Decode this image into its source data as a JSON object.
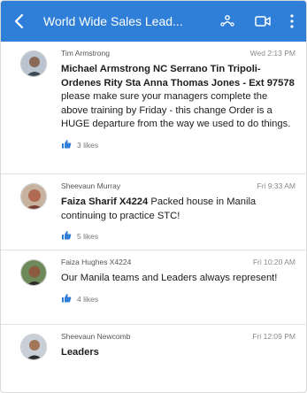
{
  "header": {
    "title": "World Wide Sales Lead...",
    "back_icon": "back-arrow-icon",
    "people_icon": "people-icon",
    "video_icon": "video-call-icon",
    "more_icon": "more-vertical-icon",
    "bar_color": "#2f7fd9"
  },
  "messages": [
    {
      "author": "Tim Armstrong",
      "time": "Wed 2:13 PM",
      "mention": "Michael Armstrong NC Serrano Tin Tripoli-Ordenes Rity Sta Anna Thomas Jones - Ext 97578",
      "text": " please make sure your managers complete the above training by Friday - this change Order is a HUGE departure from the way we used to do things.",
      "likes": "3 likes"
    },
    {
      "author": "Sheevaun Murray",
      "time": "Fri 9:33 AM",
      "mention": "Faiza Sharif X4224",
      "text": " Packed house in Manila continuing to practice STC!",
      "likes": "5 likes"
    },
    {
      "author": "Faiza Hughes X4224",
      "time": "Fri 10:20 AM",
      "mention": "",
      "text": "Our Manila teams and Leaders always represent!",
      "likes": "4 likes"
    },
    {
      "author": "Sheevaun Newcomb",
      "time": "Fri 12:09 PM",
      "mention": "Leaders",
      "text": "",
      "likes": ""
    }
  ]
}
